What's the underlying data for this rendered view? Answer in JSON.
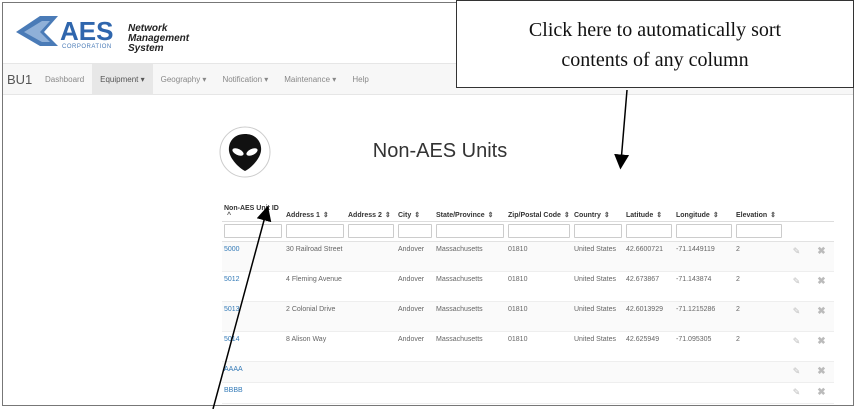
{
  "logo": {
    "name": "AES",
    "corp": "CORPORATION",
    "title": "Network Management System"
  },
  "callout": {
    "line1": "Click here to automatically sort",
    "line2": "contents of any column"
  },
  "nav": {
    "brand": "BU1",
    "items": [
      "Dashboard",
      "Equipment ▾",
      "Geography ▾",
      "Notification ▾",
      "Maintenance ▾",
      "Help"
    ]
  },
  "page": {
    "title": "Non-AES Units"
  },
  "table": {
    "headers": [
      {
        "label": "Non-AES Unit ID",
        "sort": "^"
      },
      {
        "label": "Address 1",
        "sort": "⇕"
      },
      {
        "label": "Address 2",
        "sort": "⇕"
      },
      {
        "label": "City",
        "sort": "⇕"
      },
      {
        "label": "State/Province",
        "sort": "⇕"
      },
      {
        "label": "Zip/Postal Code",
        "sort": "⇕"
      },
      {
        "label": "Country",
        "sort": "⇕"
      },
      {
        "label": "Latitude",
        "sort": "⇕"
      },
      {
        "label": "Longitude",
        "sort": "⇕"
      },
      {
        "label": "Elevation",
        "sort": "⇕"
      }
    ],
    "rows": [
      {
        "id": "5000",
        "address1": "30 Railroad Street",
        "address2": "",
        "city": "Andover",
        "state": "Massachusetts",
        "zip": "01810",
        "country": "United States",
        "lat": "42.6600721",
        "lon": "-71.1449119",
        "elev": "2"
      },
      {
        "id": "5012",
        "address1": "4 Fleming Avenue",
        "address2": "",
        "city": "Andover",
        "state": "Massachusetts",
        "zip": "01810",
        "country": "United States",
        "lat": "42.673867",
        "lon": "-71.143874",
        "elev": "2"
      },
      {
        "id": "5013",
        "address1": "2 Colonial Drive",
        "address2": "",
        "city": "Andover",
        "state": "Massachusetts",
        "zip": "01810",
        "country": "United States",
        "lat": "42.6013929",
        "lon": "-71.1215286",
        "elev": "2"
      },
      {
        "id": "5014",
        "address1": "8 Alison Way",
        "address2": "",
        "city": "Andover",
        "state": "Massachusetts",
        "zip": "01810",
        "country": "United States",
        "lat": "42.625949",
        "lon": "-71.095305",
        "elev": "2"
      },
      {
        "id": "AAAA",
        "address1": "",
        "address2": "",
        "city": "",
        "state": "",
        "zip": "",
        "country": "",
        "lat": "",
        "lon": "",
        "elev": ""
      },
      {
        "id": "BBBB",
        "address1": "",
        "address2": "",
        "city": "",
        "state": "",
        "zip": "",
        "country": "",
        "lat": "",
        "lon": "",
        "elev": ""
      }
    ],
    "edit_icon": "✎",
    "delete_icon": "✖"
  }
}
